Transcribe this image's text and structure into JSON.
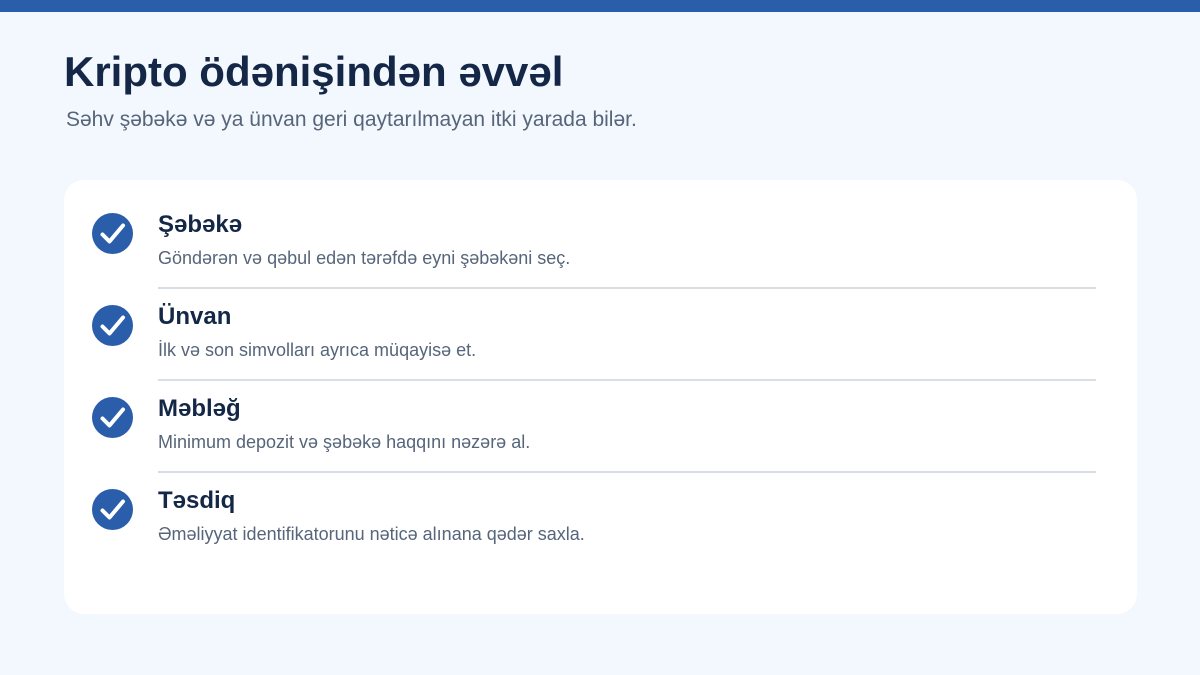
{
  "header": {
    "title": "Kripto ödənişindən əvvəl",
    "subtitle": "Səhv şəbəkə və ya ünvan geri qaytarılmayan itki yarada bilər."
  },
  "checklist": {
    "items": [
      {
        "title": "Şəbəkə",
        "description": "Göndərən və qəbul edən tərəfdə eyni şəbəkəni seç.",
        "icon": "check-circle-icon"
      },
      {
        "title": "Ünvan",
        "description": "İlk və son simvolları ayrıca müqayisə et.",
        "icon": "check-circle-icon"
      },
      {
        "title": "Məbləğ",
        "description": "Minimum depozit və şəbəkə haqqını nəzərə al.",
        "icon": "check-circle-icon"
      },
      {
        "title": "Təsdiq",
        "description": "Əməliyyat identifikatorunu nəticə alınana qədər saxla.",
        "icon": "check-circle-icon"
      }
    ]
  },
  "colors": {
    "accent": "#2a5daa",
    "background": "#f3f7fe",
    "card": "#ffffff",
    "title": "#142747",
    "muted_text": "#56657a",
    "divider": "#d9dee5"
  }
}
